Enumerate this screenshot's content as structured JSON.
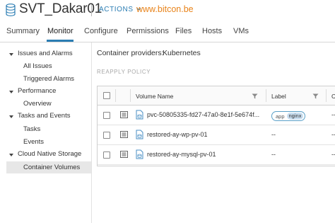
{
  "header": {
    "title": "SVT_Dakar01",
    "actions_label": "ACTIONS",
    "watermark": "www.bitcon.be"
  },
  "tabs": [
    {
      "label": "Summary"
    },
    {
      "label": "Monitor"
    },
    {
      "label": "Configure"
    },
    {
      "label": "Permissions"
    },
    {
      "label": "Files"
    },
    {
      "label": "Hosts"
    },
    {
      "label": "VMs"
    }
  ],
  "active_tab": "Monitor",
  "sidebar": {
    "sections": [
      {
        "label": "Issues and Alarms",
        "items": [
          "All Issues",
          "Triggered Alarms"
        ]
      },
      {
        "label": "Performance",
        "items": [
          "Overview"
        ]
      },
      {
        "label": "Tasks and Events",
        "items": [
          "Tasks",
          "Events"
        ]
      },
      {
        "label": "Cloud Native Storage",
        "items": [
          "Container Volumes"
        ]
      }
    ],
    "selected": "Container Volumes"
  },
  "main": {
    "providers_label": "Container providers:",
    "providers_value": "Kubernetes",
    "reapply_label": "REAPPLY POLICY",
    "columns": [
      "Volume Name",
      "Label",
      "C"
    ],
    "rows": [
      {
        "volume_name": "pvc-50805335-fd27-47a0-8e1f-5e674f...",
        "label_key": "app",
        "label_value": "nginx",
        "tail": "--"
      },
      {
        "volume_name": "restored-ay-wp-pv-01",
        "label_text": "--",
        "tail": "--"
      },
      {
        "volume_name": "restored-ay-mysql-pv-01",
        "label_text": "--",
        "tail": "--"
      }
    ]
  },
  "colors": {
    "accent": "#2b7db3",
    "watermark": "#e8831a",
    "selected_bg": "#e7e7e7",
    "badge_bg": "#c9def0"
  },
  "icons": [
    "datastore-icon",
    "chevron-down-icon",
    "caret-down-icon",
    "filter-icon",
    "details-icon",
    "volume-icon"
  ]
}
